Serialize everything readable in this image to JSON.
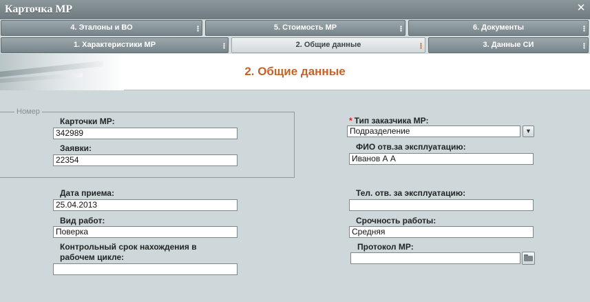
{
  "window": {
    "title": "Карточка МР"
  },
  "tabs_row1": [
    {
      "label": "4. Эталоны и ВО"
    },
    {
      "label": "5. Стоимость МР"
    },
    {
      "label": "6. Документы"
    }
  ],
  "tabs_row2": [
    {
      "label": "1. Характеристики МР"
    },
    {
      "label": "2. Общие данные",
      "active": true
    },
    {
      "label": "3. Данные СИ"
    }
  ],
  "page": {
    "heading": "2. Общие данные"
  },
  "group_nomer": {
    "legend": "Номер",
    "card_label": "Карточки МР:",
    "card_value": "342989",
    "request_label": "Заявки:",
    "request_value": "22354"
  },
  "left": {
    "date_label": "Дата приема:",
    "date_value": "25.04.2013",
    "work_label": "Вид работ:",
    "work_value": "Поверка",
    "deadline_label_1": "Контрольный срок нахождения в",
    "deadline_label_2": "рабочем цикле:",
    "deadline_value": ""
  },
  "right": {
    "customer_type_label": "Тип заказчика МР:",
    "required_mark": "*",
    "customer_type_value": "Подразделение",
    "fio_label": "ФИО отв.за эксплуатацию:",
    "fio_value": "Иванов А А",
    "phone_label": "Тел. отв. за эксплуатацию:",
    "phone_value": "",
    "urgency_label": "Срочность работы:",
    "urgency_value": "Средняя",
    "protocol_label": "Протокол МР:",
    "protocol_value": ""
  },
  "icons": {
    "close": "close-icon",
    "dropdown": "chevron-down-icon",
    "browse": "folder-open-icon"
  },
  "colors": {
    "heading": "#c5622a",
    "required": "#d0231c",
    "background": "#ced7d9"
  }
}
